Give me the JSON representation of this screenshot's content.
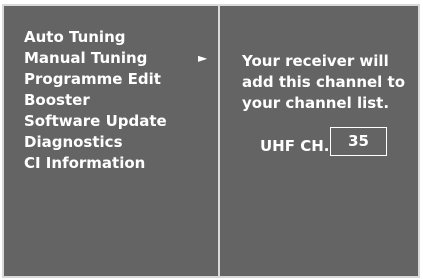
{
  "menu": {
    "items": [
      {
        "label": "Auto Tuning"
      },
      {
        "label": "Manual Tuning"
      },
      {
        "label": "Programme Edit"
      },
      {
        "label": "Booster"
      },
      {
        "label": "Software Update"
      },
      {
        "label": "Diagnostics"
      },
      {
        "label": "CI Information"
      }
    ],
    "selected_index": 1,
    "submenu_arrow": "►"
  },
  "panel": {
    "message_lines": [
      "Your receiver will",
      "add this channel to",
      "your channel list."
    ],
    "channel_label": "UHF CH.",
    "channel_value": "35"
  },
  "colors": {
    "background": "#646464",
    "border": "#d9d9d9",
    "text": "#ffffff"
  }
}
